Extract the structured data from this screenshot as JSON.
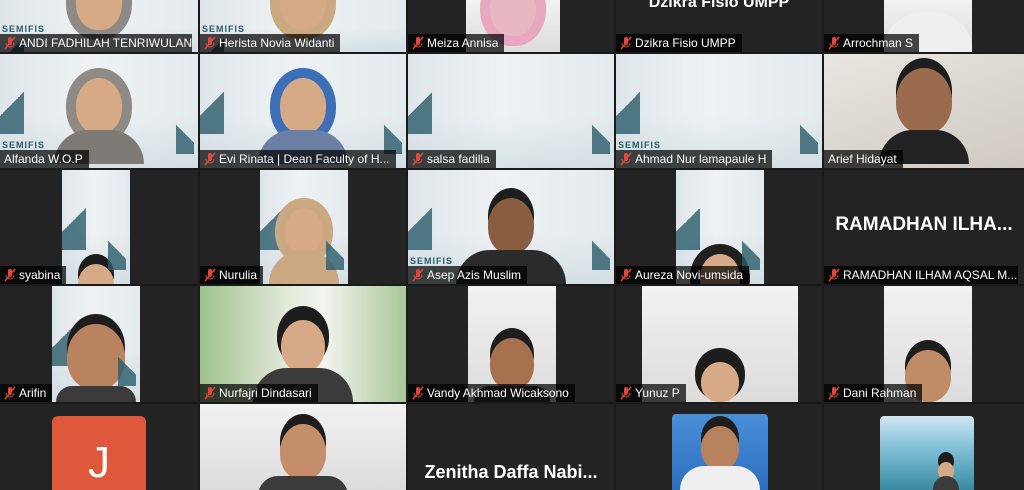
{
  "participants": [
    {
      "id": "andi",
      "name": "ANDI FADHILAH TENRIWULAN",
      "muted": true,
      "label": "SEMIFIS"
    },
    {
      "id": "herista",
      "name": "Herista Novia Widanti",
      "muted": true,
      "label": "SEMIFIS"
    },
    {
      "id": "meiza",
      "name": "Meiza Annisa",
      "muted": true
    },
    {
      "id": "dzikra",
      "name": "Dzikra Fisio UMPP",
      "muted": true,
      "top_text": "Dzikra Fisio UMPP"
    },
    {
      "id": "arrochman",
      "name": "Arrochman S",
      "muted": true
    },
    {
      "id": "alfanda",
      "name": "Alfanda W.O.P",
      "muted": false,
      "active": true,
      "label": "SEMIFIS"
    },
    {
      "id": "evi",
      "name": "Evi Rinata | Dean Faculty of H...",
      "muted": true
    },
    {
      "id": "salsa",
      "name": "salsa fadilla",
      "muted": true
    },
    {
      "id": "ahmad",
      "name": "Ahmad Nur lamapaule H",
      "muted": true,
      "label": "SEMIFIS"
    },
    {
      "id": "arief",
      "name": "Arief Hidayat",
      "muted": false
    },
    {
      "id": "syabina",
      "name": "syabina",
      "muted": true
    },
    {
      "id": "nurulia",
      "name": "Nurulia",
      "muted": true
    },
    {
      "id": "asep",
      "name": "Asep Azis Muslim",
      "muted": true,
      "label": "SEMIFIS"
    },
    {
      "id": "aureza",
      "name": "Aureza Novi-umsida",
      "muted": true
    },
    {
      "id": "ramadhan",
      "name": "RAMADHAN ILHAM AQSAL M...",
      "muted": true,
      "big_name": "RAMADHAN ILHA..."
    },
    {
      "id": "arifin",
      "name": "Arifin",
      "muted": true
    },
    {
      "id": "nurfajri",
      "name": "Nurfajri Dindasari",
      "muted": true
    },
    {
      "id": "vandy",
      "name": "Vandy Akhmad Wicaksono",
      "muted": true
    },
    {
      "id": "yunuz",
      "name": "Yunuz P",
      "muted": true
    },
    {
      "id": "dani",
      "name": "Dani Rahman",
      "muted": true
    },
    {
      "id": "j",
      "name": "",
      "avatar_letter": "J"
    },
    {
      "id": "p22",
      "name": ""
    },
    {
      "id": "zenitha",
      "name": "",
      "big_name": "Zenitha Daffa Nabi..."
    },
    {
      "id": "p24",
      "name": ""
    },
    {
      "id": "p25",
      "name": ""
    }
  ],
  "colors": {
    "active_border": "#2fd05c",
    "muted_icon": "#e0463a",
    "tile_bg": "#232323"
  }
}
